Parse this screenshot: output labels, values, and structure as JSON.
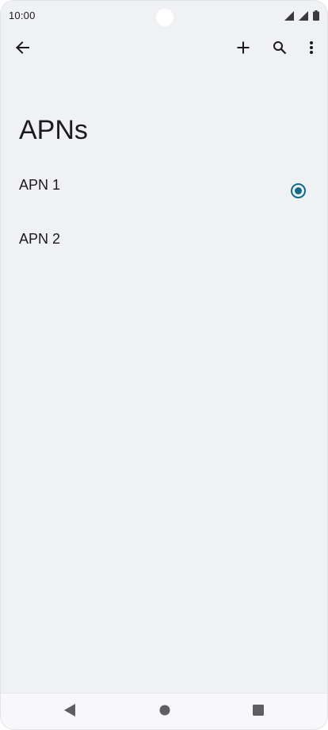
{
  "status_bar": {
    "time": "10:00",
    "icons": [
      "signal-icon",
      "signal-icon",
      "battery-icon"
    ]
  },
  "app_bar": {
    "icons": [
      "arrow-back-icon",
      "add-icon",
      "search-icon",
      "more-vert-icon"
    ]
  },
  "page": {
    "title": "APNs"
  },
  "apn_list": {
    "items": [
      {
        "label": "APN 1",
        "selected": true
      },
      {
        "label": "APN 2",
        "selected": false
      }
    ]
  },
  "nav_bar": {
    "icons": [
      "nav-back-icon",
      "nav-home-icon",
      "nav-recents-icon"
    ]
  },
  "colors": {
    "background": "#f0f1f4",
    "accent": "#0e6b8a",
    "text": "#1b1b1f"
  }
}
